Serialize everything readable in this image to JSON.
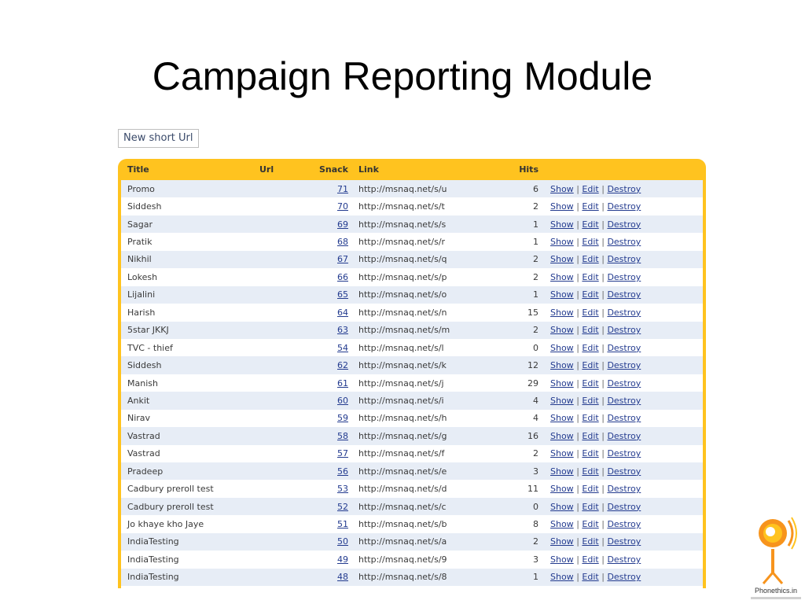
{
  "slide": {
    "title": "Campaign Reporting Module"
  },
  "toolbar": {
    "new_label": "New short Url"
  },
  "table": {
    "columns": [
      "Title",
      "Url",
      "Snack",
      "Link",
      "Hits"
    ],
    "actions": {
      "show": "Show",
      "edit": "Edit",
      "destroy": "Destroy",
      "separator": "|"
    },
    "rows": [
      {
        "title": "Promo",
        "url": "",
        "snack": "71",
        "link": "http://msnaq.net/s/u",
        "hits": "6"
      },
      {
        "title": "Siddesh",
        "url": "",
        "snack": "70",
        "link": "http://msnaq.net/s/t",
        "hits": "2"
      },
      {
        "title": "Sagar",
        "url": "",
        "snack": "69",
        "link": "http://msnaq.net/s/s",
        "hits": "1"
      },
      {
        "title": "Pratik",
        "url": "",
        "snack": "68",
        "link": "http://msnaq.net/s/r",
        "hits": "1"
      },
      {
        "title": "Nikhil",
        "url": "",
        "snack": "67",
        "link": "http://msnaq.net/s/q",
        "hits": "2"
      },
      {
        "title": "Lokesh",
        "url": "",
        "snack": "66",
        "link": "http://msnaq.net/s/p",
        "hits": "2"
      },
      {
        "title": "Lijalini",
        "url": "",
        "snack": "65",
        "link": "http://msnaq.net/s/o",
        "hits": "1"
      },
      {
        "title": "Harish",
        "url": "",
        "snack": "64",
        "link": "http://msnaq.net/s/n",
        "hits": "15"
      },
      {
        "title": "5star JKKJ",
        "url": "",
        "snack": "63",
        "link": "http://msnaq.net/s/m",
        "hits": "2"
      },
      {
        "title": "TVC - thief",
        "url": "",
        "snack": "54",
        "link": "http://msnaq.net/s/l",
        "hits": "0"
      },
      {
        "title": "Siddesh",
        "url": "",
        "snack": "62",
        "link": "http://msnaq.net/s/k",
        "hits": "12"
      },
      {
        "title": "Manish",
        "url": "",
        "snack": "61",
        "link": "http://msnaq.net/s/j",
        "hits": "29"
      },
      {
        "title": "Ankit",
        "url": "",
        "snack": "60",
        "link": "http://msnaq.net/s/i",
        "hits": "4"
      },
      {
        "title": "Nirav",
        "url": "",
        "snack": "59",
        "link": "http://msnaq.net/s/h",
        "hits": "4"
      },
      {
        "title": "Vastrad",
        "url": "",
        "snack": "58",
        "link": "http://msnaq.net/s/g",
        "hits": "16"
      },
      {
        "title": "Vastrad",
        "url": "",
        "snack": "57",
        "link": "http://msnaq.net/s/f",
        "hits": "2"
      },
      {
        "title": "Pradeep",
        "url": "",
        "snack": "56",
        "link": "http://msnaq.net/s/e",
        "hits": "3"
      },
      {
        "title": "Cadbury preroll test",
        "url": "",
        "snack": "53",
        "link": "http://msnaq.net/s/d",
        "hits": "11"
      },
      {
        "title": "Cadbury preroll test",
        "url": "",
        "snack": "52",
        "link": "http://msnaq.net/s/c",
        "hits": "0"
      },
      {
        "title": "Jo khaye kho Jaye",
        "url": "",
        "snack": "51",
        "link": "http://msnaq.net/s/b",
        "hits": "8"
      },
      {
        "title": "IndiaTesting",
        "url": "",
        "snack": "50",
        "link": "http://msnaq.net/s/a",
        "hits": "2"
      },
      {
        "title": "IndiaTesting",
        "url": "",
        "snack": "49",
        "link": "http://msnaq.net/s/9",
        "hits": "3"
      },
      {
        "title": "IndiaTesting",
        "url": "",
        "snack": "48",
        "link": "http://msnaq.net/s/8",
        "hits": "1"
      }
    ]
  },
  "logo": {
    "name": "Phonethics.in",
    "icon": "phonethics-logo-icon",
    "colors": {
      "orange": "#f7941d",
      "yellow": "#ffc31f"
    }
  },
  "colors": {
    "frame": "#ffc31f",
    "row_alt": "#e7edf6",
    "link": "#233b8f"
  }
}
